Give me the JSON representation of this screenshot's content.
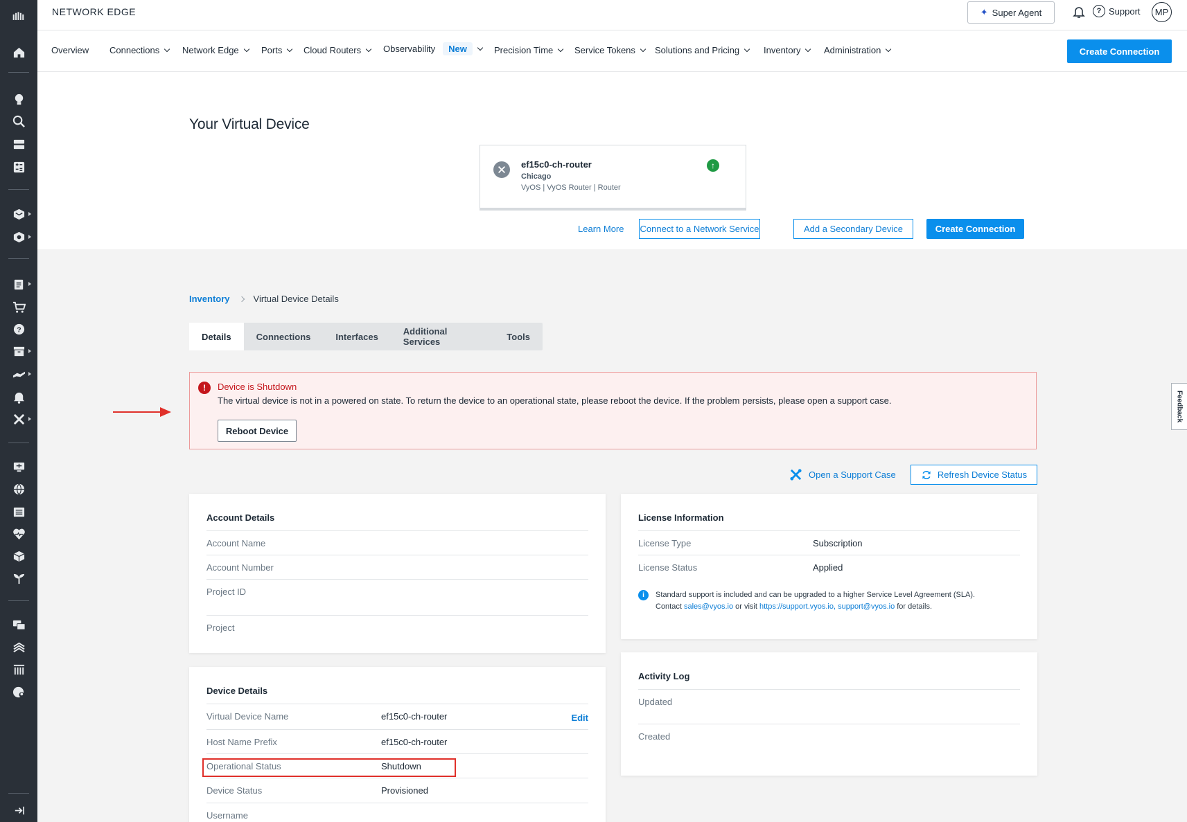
{
  "rail": {
    "icons": [
      "logo-icon",
      "home-icon",
      "lightbulb-icon",
      "search-icon",
      "storage-icon",
      "calculator-icon",
      "layers-icon",
      "network-icon",
      "reports-icon",
      "cart-icon",
      "help-icon",
      "archive-icon",
      "handshake-icon",
      "bell-icon",
      "tools-icon",
      "monitor-icon",
      "globe-icon",
      "catalog-icon",
      "health-icon",
      "cube-icon",
      "sprout-icon",
      "chat-icon",
      "stack-icon",
      "columns-icon",
      "world-user-icon",
      "collapse-icon"
    ]
  },
  "topbar": {
    "brand": "NETWORK EDGE",
    "super_agent": "Super Agent",
    "support": "Support",
    "avatar": "MP"
  },
  "nav": {
    "items": [
      {
        "label": "Overview"
      },
      {
        "label": "Connections"
      },
      {
        "label": "Network Edge"
      },
      {
        "label": "Ports"
      },
      {
        "label": "Cloud Routers"
      },
      {
        "label": "Observability"
      },
      {
        "label": "Precision Time"
      },
      {
        "label": "Service Tokens"
      },
      {
        "label": "Solutions and Pricing"
      },
      {
        "label": "Inventory"
      },
      {
        "label": "Administration"
      }
    ],
    "new_badge": "New",
    "create": "Create Connection"
  },
  "hero": {
    "title": "Your Virtual Device",
    "device": {
      "name": "ef15c0-ch-router",
      "location": "Chicago",
      "meta": "VyOS | VyOS Router | Router",
      "status_color": "#1f9a44"
    },
    "learn_more": "Learn More",
    "connect": "Connect to a Network Service",
    "secondary": "Add a Secondary Device",
    "create": "Create Connection"
  },
  "breadcrumb": {
    "parent": "Inventory",
    "current": "Virtual Device Details"
  },
  "tabs": [
    "Details",
    "Connections",
    "Interfaces",
    "Additional Services",
    "Tools"
  ],
  "alert": {
    "title": "Device is Shutdown",
    "message": "The virtual device is not in a powered on state. To return the device to an operational state, please reboot the device. If the problem persists, please open a support case.",
    "button": "Reboot Device",
    "color": "#c4161c"
  },
  "actions": {
    "support_case": "Open a Support Case",
    "refresh": "Refresh Device Status"
  },
  "account": {
    "title": "Account Details",
    "rows": [
      {
        "label": "Account Name",
        "value": ""
      },
      {
        "label": "Account Number",
        "value": ""
      },
      {
        "label": "Project ID",
        "value": ""
      },
      {
        "label": "Project",
        "value": ""
      }
    ]
  },
  "license": {
    "title": "License Information",
    "rows": [
      {
        "label": "License Type",
        "value": "Subscription"
      },
      {
        "label": "License Status",
        "value": "Applied"
      }
    ],
    "info_line1": "Standard support is included and can be upgraded to a higher Service Level Agreement (SLA).",
    "info_contact": "Contact",
    "info_email": "sales@vyos.io",
    "info_or": "or visit",
    "info_link": "https://support.vyos.io, support@vyos.io",
    "info_end": "for details."
  },
  "device": {
    "title": "Device Details",
    "edit": "Edit",
    "rows": [
      {
        "label": "Virtual Device Name",
        "value": "ef15c0-ch-router"
      },
      {
        "label": "Host Name Prefix",
        "value": "ef15c0-ch-router"
      },
      {
        "label": "Operational Status",
        "value": "Shutdown"
      },
      {
        "label": "Device Status",
        "value": "Provisioned"
      },
      {
        "label": "Username",
        "value": ""
      }
    ]
  },
  "activity": {
    "title": "Activity Log",
    "rows": [
      {
        "label": "Updated",
        "value": ""
      },
      {
        "label": "Created",
        "value": ""
      }
    ]
  },
  "feedback": "Feedback",
  "colors": {
    "accent": "#0a8fec",
    "rail": "#2a3038",
    "highlight": "#e0302a"
  }
}
